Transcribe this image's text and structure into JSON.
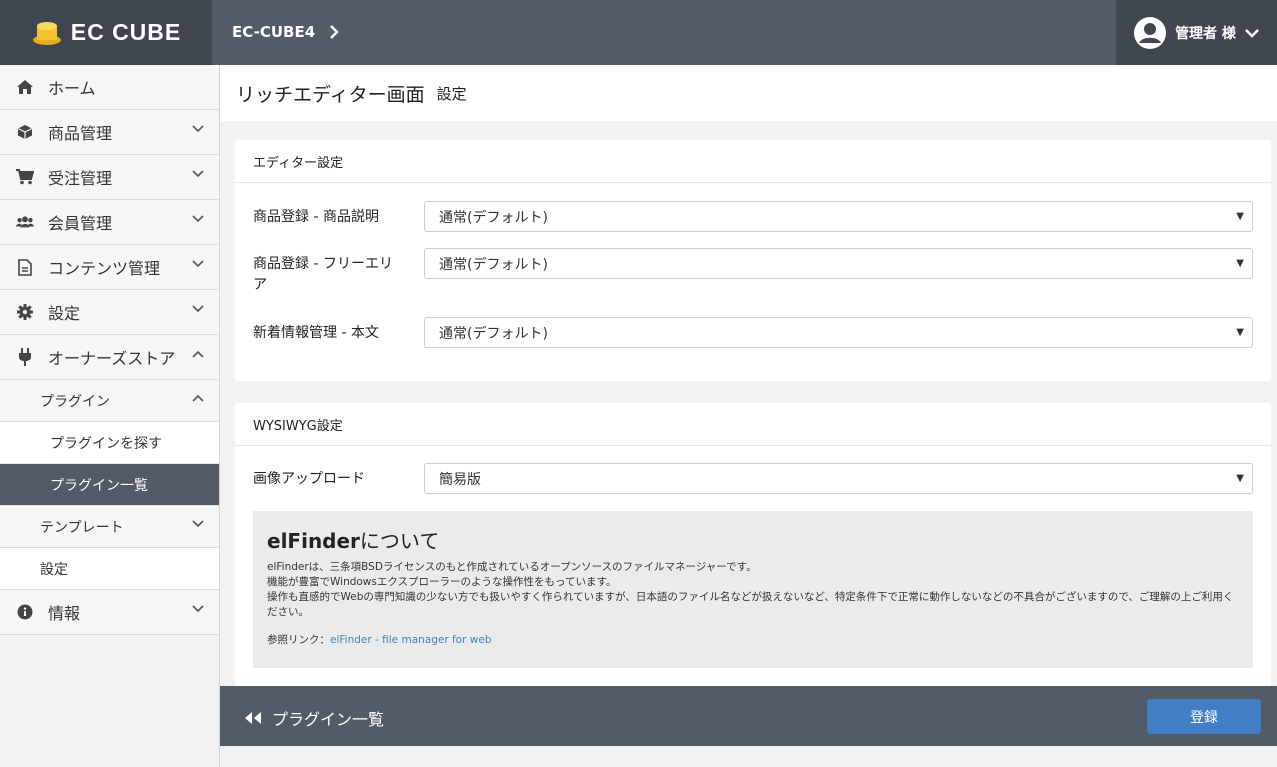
{
  "header": {
    "logo": "EC CUBE",
    "breadcrumb": "EC-CUBE4",
    "user": "管理者 様"
  },
  "sidebar": {
    "items": [
      {
        "label": "ホーム",
        "icon": "home-icon"
      },
      {
        "label": "商品管理",
        "icon": "cube-icon"
      },
      {
        "label": "受注管理",
        "icon": "cart-icon"
      },
      {
        "label": "会員管理",
        "icon": "users-icon"
      },
      {
        "label": "コンテンツ管理",
        "icon": "file-icon"
      },
      {
        "label": "設定",
        "icon": "gear-icon"
      },
      {
        "label": "オーナーズストア",
        "icon": "plug-icon"
      }
    ],
    "plugin": "プラグイン",
    "plugin_search": "プラグインを探す",
    "plugin_list": "プラグイン一覧",
    "template": "テンプレート",
    "setting": "設定",
    "info": "情報"
  },
  "page": {
    "title": "リッチエディター画面",
    "subtitle": "設定"
  },
  "editor_card": {
    "header": "エディター設定",
    "rows": [
      {
        "label": "商品登録 - 商品説明",
        "value": "通常(デフォルト)"
      },
      {
        "label": "商品登録 - フリーエリア",
        "value": "通常(デフォルト)"
      },
      {
        "label": "新着情報管理 - 本文",
        "value": "通常(デフォルト)"
      }
    ]
  },
  "wysiwyg_card": {
    "header": "WYSIWYG設定",
    "upload_label": "画像アップロード",
    "upload_value": "簡易版",
    "info_title_bold": "elFinder",
    "info_title_rest": "について",
    "info_lines": [
      "elFinderは、三条項BSDライセンスのもと作成されているオープンソースのファイルマネージャーです。",
      "機能が豊富でWindowsエクスプローラーのような操作性をもっています。",
      "操作も直感的でWebの専門知識の少ない方でも扱いやすく作られていますが、日本語のファイル名などが扱えないなど、特定条件下で正常に動作しないなどの不具合がございますので、ご理解の上ご利用ください。"
    ],
    "ref_label": "参照リンク：",
    "ref_link": "elFinder - file manager for web"
  },
  "footer": {
    "back_label": "プラグイン一覧",
    "submit_label": "登録"
  },
  "colors": {
    "header_bg": "#525b66",
    "logo_bg": "#3f464f",
    "accent": "#437ec4"
  }
}
